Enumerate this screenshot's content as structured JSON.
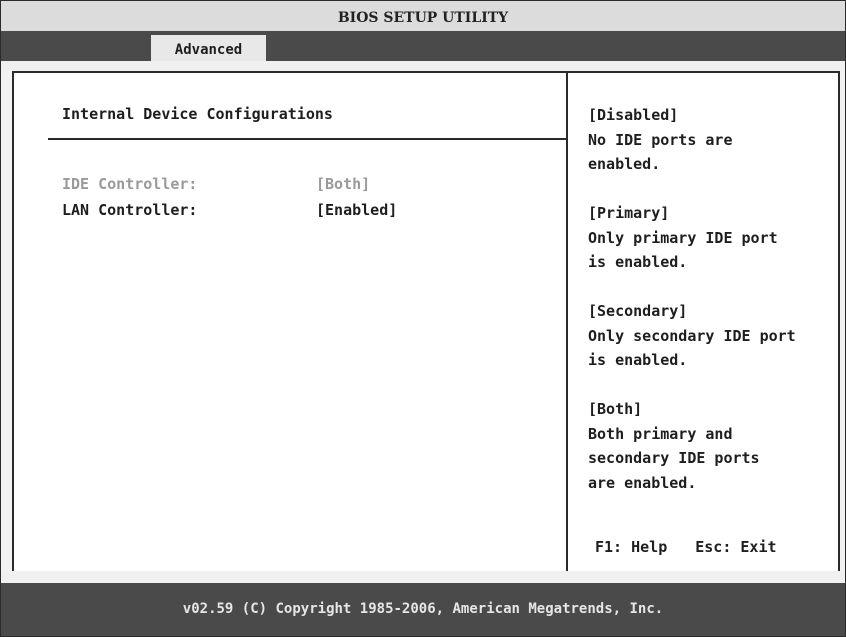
{
  "title": "BIOS SETUP UTILITY",
  "tabs": [
    {
      "label": "Advanced",
      "active": true
    }
  ],
  "main": {
    "section_title": "Internal Device Configurations",
    "settings": [
      {
        "label": "IDE Controller:",
        "value": "[Both]",
        "enabled": false
      },
      {
        "label": "LAN Controller:",
        "value": "[Enabled]",
        "enabled": true
      }
    ]
  },
  "help": {
    "blocks": [
      {
        "lines": [
          "[Disabled]",
          "No IDE ports are",
          "enabled."
        ]
      },
      {
        "lines": [
          "[Primary]",
          "Only primary IDE port",
          "is enabled."
        ]
      },
      {
        "lines": [
          "[Secondary]",
          "Only secondary IDE port",
          "is enabled."
        ]
      },
      {
        "lines": [
          "[Both]",
          "Both primary and",
          "secondary IDE ports",
          "are enabled."
        ]
      }
    ],
    "keys": {
      "help": "F1: Help",
      "exit": "Esc: Exit"
    }
  },
  "footer": "v02.59 (C) Copyright 1985-2006, American Megatrends, Inc.",
  "colors": {
    "bar_background": "#4a4a4a",
    "disabled_text": "#9a9a9a",
    "text": "#1e1e1e"
  }
}
